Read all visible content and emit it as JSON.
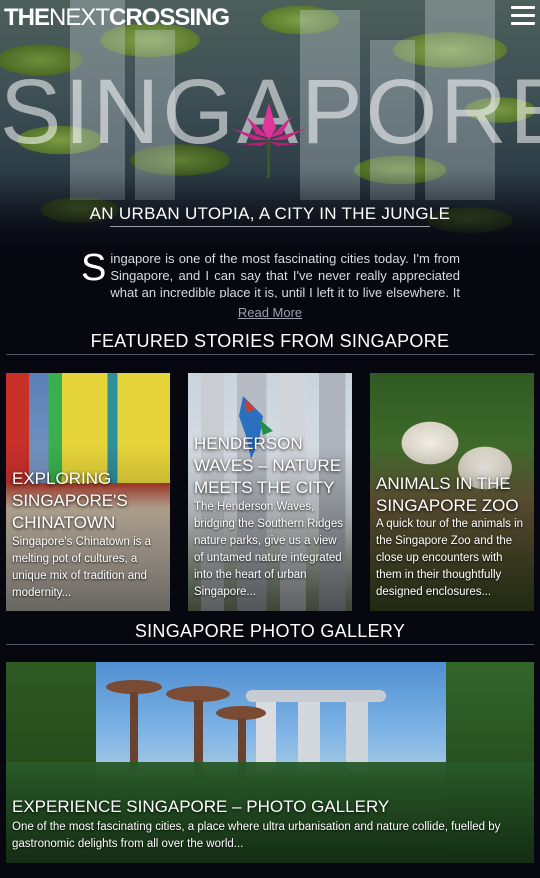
{
  "site": {
    "logo_bold": "THE",
    "logo_thin": "NEXT",
    "logo_bold2": "CROSSING"
  },
  "hero": {
    "title": "SINGAPORE",
    "subtitle": "AN URBAN UTOPIA, A CITY IN THE JUNGLE"
  },
  "intro": {
    "dropcap": "S",
    "text": "ingapore is one of the most fascinating cities today. I'm from Singapore, and I can say that I've never really appreciated what an incredible place it is, until I left it to live elsewhere. It is, in many ways, a",
    "read_more": "Read More"
  },
  "featured": {
    "heading": "FEATURED STORIES FROM SINGAPORE",
    "cards": [
      {
        "title": "Exploring Singapore's Chinatown",
        "text": "Singapore's Chinatown is a melting pot of cultures, a unique mix of tradition and modernity..."
      },
      {
        "title": "Henderson Waves – Nature Meets the City",
        "text": "The Henderson Waves, bridging the Southern Ridges nature parks, give us a view of untamed nature integrated into the heart of urban Singapore..."
      },
      {
        "title": "Animals in the Singapore Zoo",
        "text": "A quick tour of the animals in the Singapore Zoo and the close up encounters with them in their thoughtfully designed enclosures..."
      }
    ]
  },
  "gallery": {
    "heading": "SINGAPORE PHOTO GALLERY",
    "title": "EXPERIENCE SINGAPORE – PHOTO GALLERY",
    "text": "One of the most fascinating cities, a place where ultra urbanisation and nature collide, fuelled by gastronomic delights from all over the world..."
  },
  "colors": {
    "background": "#07080f",
    "lotus": "#e0359a",
    "read_more": "#9aa3ad"
  }
}
